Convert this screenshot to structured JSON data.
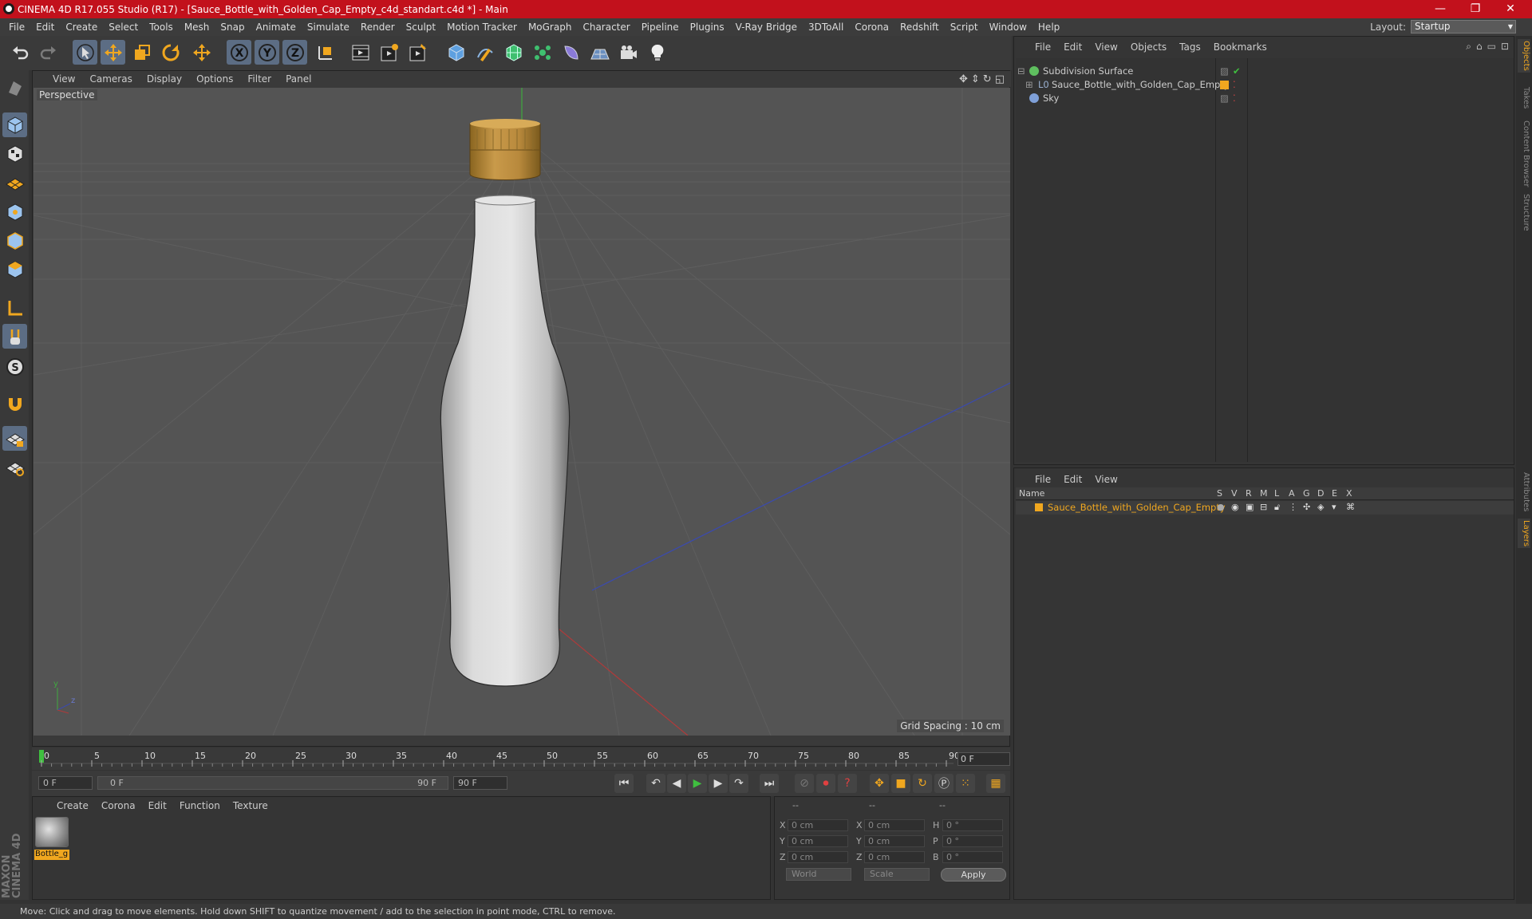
{
  "window": {
    "title": "CINEMA 4D R17.055 Studio (R17) - [Sauce_Bottle_with_Golden_Cap_Empty_c4d_standart.c4d *] - Main",
    "controls": [
      "—",
      "❐",
      "✕"
    ]
  },
  "menubar": {
    "items": [
      "File",
      "Edit",
      "Create",
      "Select",
      "Tools",
      "Mesh",
      "Snap",
      "Animate",
      "Simulate",
      "Render",
      "Sculpt",
      "Motion Tracker",
      "MoGraph",
      "Character",
      "Pipeline",
      "Plugins",
      "V-Ray Bridge",
      "3DToAll",
      "Corona",
      "Redshift",
      "Script",
      "Window",
      "Help"
    ],
    "layout_label": "Layout:",
    "layout_value": "Startup"
  },
  "toolbar": {
    "icons": [
      "undo-icon",
      "redo-icon",
      "live-selection-icon",
      "move-icon",
      "scale-icon",
      "rotate-icon",
      "world-coord-icon",
      "x-axis-icon",
      "y-axis-icon",
      "z-axis-icon",
      "coordinate-system-icon",
      "render-view-icon",
      "render-picture-viewer-icon",
      "edit-render-settings-icon",
      "cube-icon",
      "pen-icon",
      "subdivision-icon",
      "cloner-icon",
      "deformer-icon",
      "floor-icon",
      "camera-icon",
      "light-icon"
    ],
    "axis_labels": [
      "X",
      "Y",
      "Z"
    ]
  },
  "lefttools": {
    "icons": [
      "make-editable-icon",
      "model-mode-icon",
      "texture-mode-icon",
      "workplane-icon",
      "points-mode-icon",
      "edges-mode-icon",
      "polygons-mode-icon",
      "axis-mode-icon",
      "tweak-mode-icon",
      "solo-icon",
      "snap-icon",
      "workplane-lock-icon",
      "workplane-rotate-icon"
    ]
  },
  "maxon": {
    "logo_text": "MAXON CINEMA 4D"
  },
  "viewport": {
    "menu": [
      "View",
      "Cameras",
      "Display",
      "Options",
      "Filter",
      "Panel"
    ],
    "label": "Perspective",
    "grid_spacing": "Grid Spacing : 10 cm"
  },
  "timeline": {
    "ticks": [
      "0",
      "5",
      "10",
      "15",
      "20",
      "25",
      "30",
      "35",
      "40",
      "45",
      "50",
      "55",
      "60",
      "65",
      "70",
      "75",
      "80",
      "85",
      "90"
    ],
    "current_frame": "0 F"
  },
  "transport": {
    "start_field": "0 F",
    "range_start": "0 F",
    "range_end": "90 F",
    "end_field": "90 F"
  },
  "materials": {
    "menu": [
      "Create",
      "Corona",
      "Edit",
      "Function",
      "Texture"
    ],
    "items": [
      {
        "name": "Bottle_g"
      }
    ]
  },
  "coords": {
    "headers": [
      "--",
      "--",
      "--"
    ],
    "rows": [
      {
        "a": "X",
        "av": "0 cm",
        "b": "X",
        "bv": "0 cm",
        "c": "H",
        "cv": "0 °"
      },
      {
        "a": "Y",
        "av": "0 cm",
        "b": "Y",
        "bv": "0 cm",
        "c": "P",
        "cv": "0 °"
      },
      {
        "a": "Z",
        "av": "0 cm",
        "b": "Z",
        "bv": "0 cm",
        "c": "B",
        "cv": "0 °"
      }
    ],
    "mode": "World",
    "scale": "Scale",
    "apply": "Apply"
  },
  "objects": {
    "menu": [
      "File",
      "Edit",
      "View",
      "Objects",
      "Tags",
      "Bookmarks"
    ],
    "tree": [
      {
        "name": "Subdivision Surface",
        "color": "#5fbf5f"
      },
      {
        "name": "Sauce_Bottle_with_Golden_Cap_Empty",
        "color": "#9ab0d0"
      },
      {
        "name": "Sky",
        "color": "#7fa0d8"
      }
    ]
  },
  "layers": {
    "menu": [
      "File",
      "Edit",
      "View"
    ],
    "header_name": "Name",
    "columns": [
      "S",
      "V",
      "R",
      "M",
      "L",
      "A",
      "G",
      "D",
      "E",
      "X"
    ],
    "rows": [
      {
        "name": "Sauce_Bottle_with_Golden_Cap_Empty",
        "color": "#f0a71f"
      }
    ]
  },
  "right_tabs": [
    "Objects",
    "Takes",
    "Content Browser",
    "Structure",
    "Attributes",
    "Layers"
  ],
  "status": {
    "text": "Move: Click and drag to move elements. Hold down SHIFT to quantize movement / add to the selection in point mode, CTRL to remove."
  },
  "colors": {
    "title_bar": "#c2111c",
    "accent_orange": "#f0a71f",
    "selected_tool": "#5c6d84",
    "viewport_bg": "#545454"
  }
}
